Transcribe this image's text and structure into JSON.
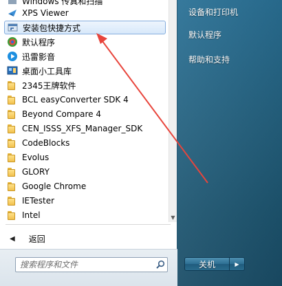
{
  "start_menu": {
    "programs": [
      {
        "label": "Windows 传真和扫描",
        "icon": "fax-icon"
      },
      {
        "label": "XPS Viewer",
        "icon": "xps-viewer-icon"
      },
      {
        "label": "安装包快捷方式",
        "icon": "shortcut-icon"
      },
      {
        "label": "默认程序",
        "icon": "default-programs-icon"
      },
      {
        "label": "迅雷影音",
        "icon": "media-player-icon"
      },
      {
        "label": "桌面小工具库",
        "icon": "gadgets-icon"
      },
      {
        "label": "2345王牌软件",
        "icon": "folder-icon"
      },
      {
        "label": "BCL easyConverter SDK 4",
        "icon": "folder-icon"
      },
      {
        "label": "Beyond Compare 4",
        "icon": "folder-icon"
      },
      {
        "label": "CEN_ISSS_XFS_Manager_SDK",
        "icon": "folder-icon"
      },
      {
        "label": "CodeBlocks",
        "icon": "folder-icon"
      },
      {
        "label": "Evolus",
        "icon": "folder-icon"
      },
      {
        "label": "GLORY",
        "icon": "folder-icon"
      },
      {
        "label": "Google Chrome",
        "icon": "folder-icon"
      },
      {
        "label": "IETester",
        "icon": "folder-icon"
      },
      {
        "label": "Intel",
        "icon": "folder-icon"
      }
    ],
    "back_label": "返回",
    "search_placeholder": "搜索程序和文件",
    "shutdown_label": "关机",
    "right_links": [
      "设备和打印机",
      "默认程序",
      "帮助和支持"
    ]
  },
  "colors": {
    "highlight_border": "#84acdd",
    "annotation_arrow": "#e8453c",
    "right_panel": "#24617f"
  }
}
